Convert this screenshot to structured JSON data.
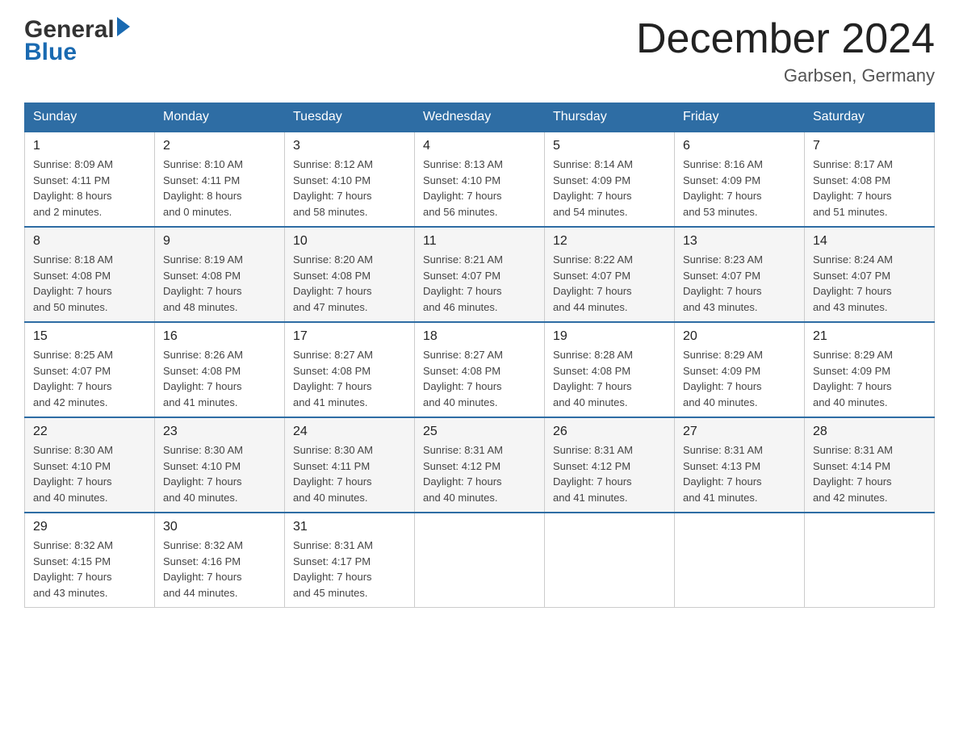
{
  "header": {
    "logo_line1": "General",
    "logo_line2": "Blue",
    "month_title": "December 2024",
    "location": "Garbsen, Germany"
  },
  "weekdays": [
    "Sunday",
    "Monday",
    "Tuesday",
    "Wednesday",
    "Thursday",
    "Friday",
    "Saturday"
  ],
  "weeks": [
    [
      {
        "day": "1",
        "sunrise": "8:09 AM",
        "sunset": "4:11 PM",
        "daylight": "8 hours and 2 minutes."
      },
      {
        "day": "2",
        "sunrise": "8:10 AM",
        "sunset": "4:11 PM",
        "daylight": "8 hours and 0 minutes."
      },
      {
        "day": "3",
        "sunrise": "8:12 AM",
        "sunset": "4:10 PM",
        "daylight": "7 hours and 58 minutes."
      },
      {
        "day": "4",
        "sunrise": "8:13 AM",
        "sunset": "4:10 PM",
        "daylight": "7 hours and 56 minutes."
      },
      {
        "day": "5",
        "sunrise": "8:14 AM",
        "sunset": "4:09 PM",
        "daylight": "7 hours and 54 minutes."
      },
      {
        "day": "6",
        "sunrise": "8:16 AM",
        "sunset": "4:09 PM",
        "daylight": "7 hours and 53 minutes."
      },
      {
        "day": "7",
        "sunrise": "8:17 AM",
        "sunset": "4:08 PM",
        "daylight": "7 hours and 51 minutes."
      }
    ],
    [
      {
        "day": "8",
        "sunrise": "8:18 AM",
        "sunset": "4:08 PM",
        "daylight": "7 hours and 50 minutes."
      },
      {
        "day": "9",
        "sunrise": "8:19 AM",
        "sunset": "4:08 PM",
        "daylight": "7 hours and 48 minutes."
      },
      {
        "day": "10",
        "sunrise": "8:20 AM",
        "sunset": "4:08 PM",
        "daylight": "7 hours and 47 minutes."
      },
      {
        "day": "11",
        "sunrise": "8:21 AM",
        "sunset": "4:07 PM",
        "daylight": "7 hours and 46 minutes."
      },
      {
        "day": "12",
        "sunrise": "8:22 AM",
        "sunset": "4:07 PM",
        "daylight": "7 hours and 44 minutes."
      },
      {
        "day": "13",
        "sunrise": "8:23 AM",
        "sunset": "4:07 PM",
        "daylight": "7 hours and 43 minutes."
      },
      {
        "day": "14",
        "sunrise": "8:24 AM",
        "sunset": "4:07 PM",
        "daylight": "7 hours and 43 minutes."
      }
    ],
    [
      {
        "day": "15",
        "sunrise": "8:25 AM",
        "sunset": "4:07 PM",
        "daylight": "7 hours and 42 minutes."
      },
      {
        "day": "16",
        "sunrise": "8:26 AM",
        "sunset": "4:08 PM",
        "daylight": "7 hours and 41 minutes."
      },
      {
        "day": "17",
        "sunrise": "8:27 AM",
        "sunset": "4:08 PM",
        "daylight": "7 hours and 41 minutes."
      },
      {
        "day": "18",
        "sunrise": "8:27 AM",
        "sunset": "4:08 PM",
        "daylight": "7 hours and 40 minutes."
      },
      {
        "day": "19",
        "sunrise": "8:28 AM",
        "sunset": "4:08 PM",
        "daylight": "7 hours and 40 minutes."
      },
      {
        "day": "20",
        "sunrise": "8:29 AM",
        "sunset": "4:09 PM",
        "daylight": "7 hours and 40 minutes."
      },
      {
        "day": "21",
        "sunrise": "8:29 AM",
        "sunset": "4:09 PM",
        "daylight": "7 hours and 40 minutes."
      }
    ],
    [
      {
        "day": "22",
        "sunrise": "8:30 AM",
        "sunset": "4:10 PM",
        "daylight": "7 hours and 40 minutes."
      },
      {
        "day": "23",
        "sunrise": "8:30 AM",
        "sunset": "4:10 PM",
        "daylight": "7 hours and 40 minutes."
      },
      {
        "day": "24",
        "sunrise": "8:30 AM",
        "sunset": "4:11 PM",
        "daylight": "7 hours and 40 minutes."
      },
      {
        "day": "25",
        "sunrise": "8:31 AM",
        "sunset": "4:12 PM",
        "daylight": "7 hours and 40 minutes."
      },
      {
        "day": "26",
        "sunrise": "8:31 AM",
        "sunset": "4:12 PM",
        "daylight": "7 hours and 41 minutes."
      },
      {
        "day": "27",
        "sunrise": "8:31 AM",
        "sunset": "4:13 PM",
        "daylight": "7 hours and 41 minutes."
      },
      {
        "day": "28",
        "sunrise": "8:31 AM",
        "sunset": "4:14 PM",
        "daylight": "7 hours and 42 minutes."
      }
    ],
    [
      {
        "day": "29",
        "sunrise": "8:32 AM",
        "sunset": "4:15 PM",
        "daylight": "7 hours and 43 minutes."
      },
      {
        "day": "30",
        "sunrise": "8:32 AM",
        "sunset": "4:16 PM",
        "daylight": "7 hours and 44 minutes."
      },
      {
        "day": "31",
        "sunrise": "8:31 AM",
        "sunset": "4:17 PM",
        "daylight": "7 hours and 45 minutes."
      },
      null,
      null,
      null,
      null
    ]
  ],
  "labels": {
    "sunrise": "Sunrise:",
    "sunset": "Sunset:",
    "daylight": "Daylight:"
  }
}
